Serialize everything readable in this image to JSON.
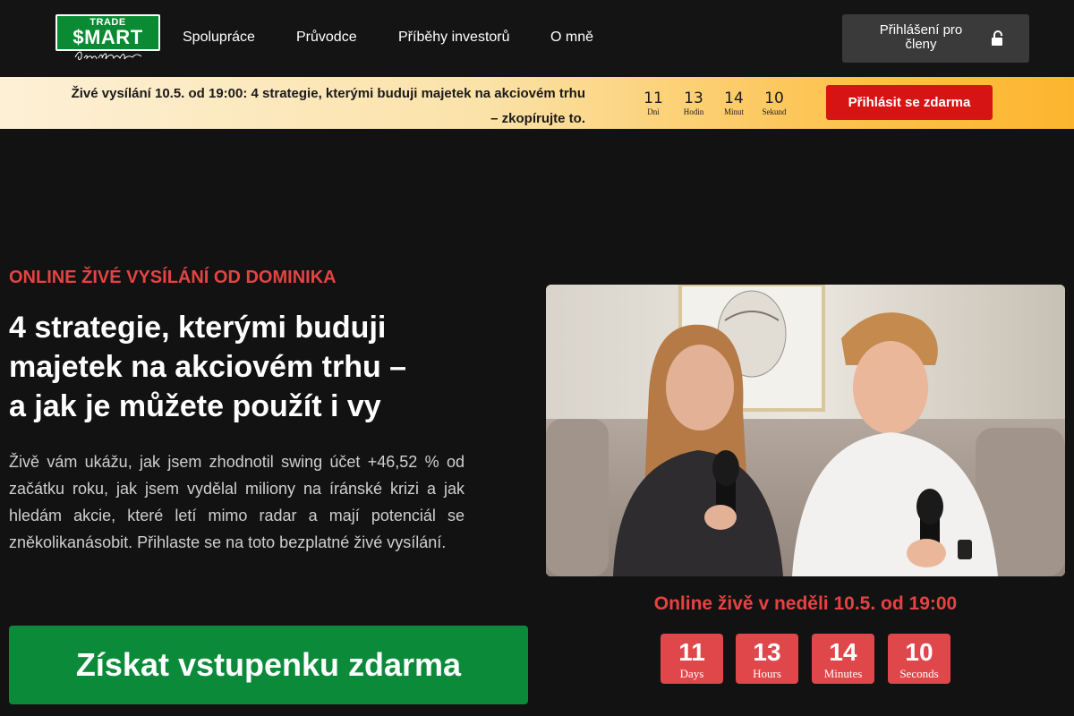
{
  "header": {
    "logo": {
      "top": "TRADE",
      "main": "$MART",
      "signature": "Dominik Kovařík"
    },
    "nav": [
      "Spolupráce",
      "Průvodce",
      "Příběhy investorů",
      "O mně"
    ],
    "login_label": "Přihlášení pro členy"
  },
  "promo": {
    "text_line1": "Živé vysílání 10.5. od 19:00: 4 strategie, kterými buduji majetek na akciovém trhu",
    "text_line2": "– zkopírujte to.",
    "countdown": [
      {
        "value": "11",
        "label": "Dni"
      },
      {
        "value": "13",
        "label": "Hodin"
      },
      {
        "value": "14",
        "label": "Minut"
      },
      {
        "value": "10",
        "label": "Sekund"
      }
    ],
    "button_label": "Přihlásit se zdarma"
  },
  "hero": {
    "eyebrow": "ONLINE ŽIVÉ VYSÍLÁNÍ OD DOMINIKA",
    "headline_line1": "4 strategie, kterými buduji",
    "headline_line2": "majetek na akciovém trhu –",
    "headline_line3": "a jak je můžete použít i vy",
    "description": "Živě vám ukážu, jak jsem zhodnotil swing účet +46,52 % od začátku roku, jak jsem vydělal miliony na íránské krizi a jak hledám akcie, které letí mimo radar a mají potenciál se zněkolikanásobit. Přihlaste se na toto bezplatné živé vysílání.",
    "cta_label": "Získat vstupenku zdarma",
    "live_date": "Online živě v neděli 10.5. od 19:00",
    "countdown": [
      {
        "value": "11",
        "label": "Days"
      },
      {
        "value": "13",
        "label": "Hours"
      },
      {
        "value": "14",
        "label": "Minutes"
      },
      {
        "value": "10",
        "label": "Seconds"
      }
    ]
  },
  "colors": {
    "accent_red": "#e54343",
    "cta_green": "#0b8a3a",
    "promo_button_red": "#d71414",
    "background": "#121212"
  }
}
